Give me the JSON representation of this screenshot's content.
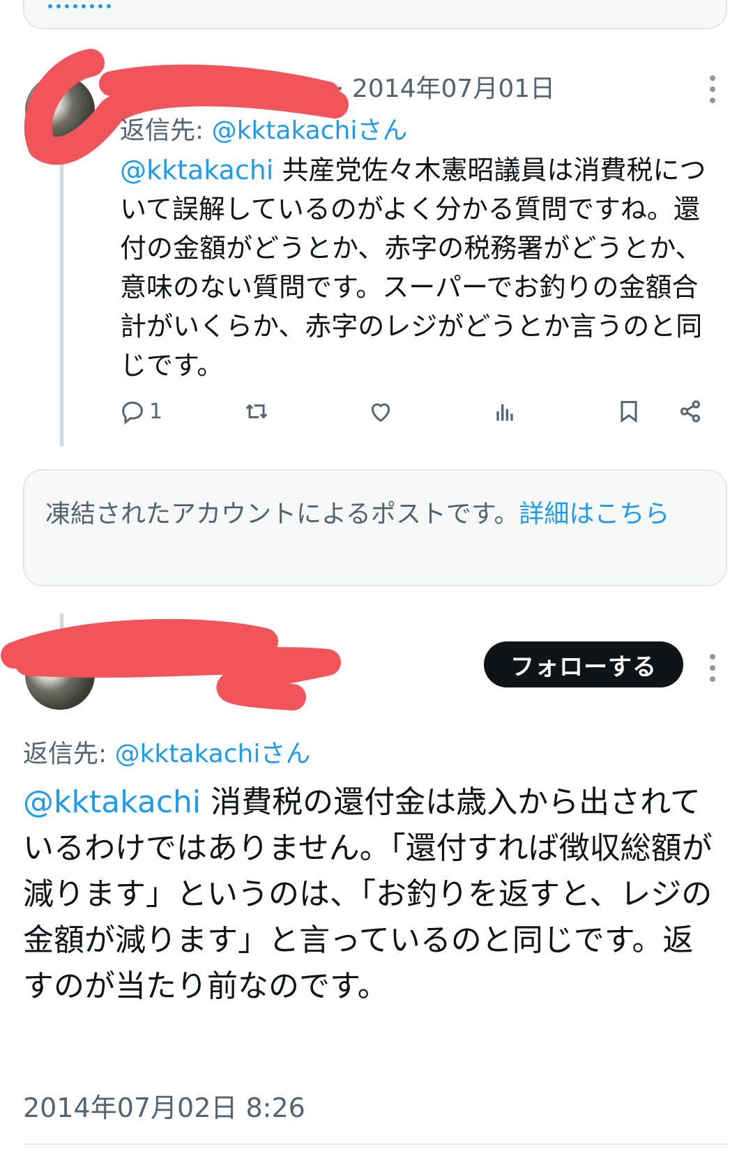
{
  "top_notice": {
    "visible_fragment": ""
  },
  "post1": {
    "timestamp": "2014年07月01日",
    "reply_prefix": "返信先: ",
    "reply_handle": "@kktakachiさん",
    "mention": "@kktakachi",
    "text": " 共産党佐々木憲昭議員は消費税について誤解しているのがよく分かる質問ですね。還付の金額がどうとか、赤字の税務署がどうとか、意味のない質問です。スーパーでお釣りの金額合計がいくらか、赤字のレジがどうとか言うのと同じです。",
    "reply_count": "1"
  },
  "suspended_notice": {
    "text": "凍結されたアカウントによるポストです。",
    "link": "詳細はこちら"
  },
  "post2": {
    "follow_label": "フォローする",
    "reply_prefix": "返信先: ",
    "reply_handle": "@kktakachiさん",
    "mention": "@kktakachi",
    "text": " 消費税の還付金は歳入から出されているわけではありません。「還付すれば徴収総額が減ります」というのは、「お釣りを返すと、レジの金額が減ります」と言っているのと同じです。返すのが当たり前なのです。",
    "timestamp": "2014年07月02日 8:26"
  },
  "colors": {
    "link": "#1d9bf0",
    "muted": "#536471",
    "text": "#0f1419",
    "redaction": "#f2545b",
    "button_bg": "#0f1419"
  },
  "icons": [
    "reply-icon",
    "retweet-icon",
    "like-icon",
    "views-icon",
    "bookmark-icon",
    "share-icon",
    "more-icon"
  ]
}
